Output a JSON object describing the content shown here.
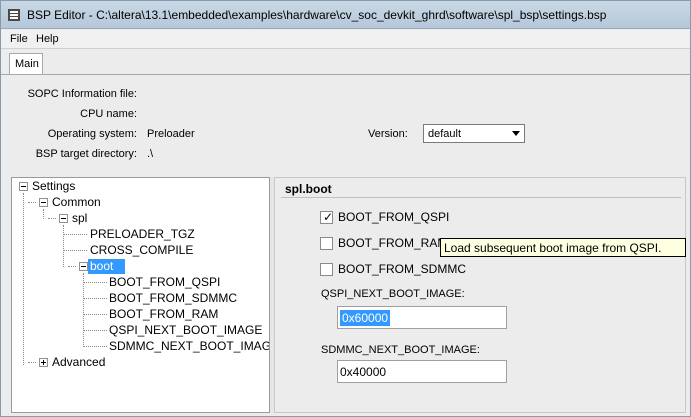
{
  "window": {
    "title": "BSP Editor - C:\\altera\\13.1\\embedded\\examples\\hardware\\cv_soc_devkit_ghrd\\software\\spl_bsp\\settings.bsp"
  },
  "menu": {
    "file": "File",
    "help": "Help"
  },
  "tabs": {
    "main": "Main"
  },
  "info": {
    "sopc_label": "SOPC Information file:",
    "cpu_label": "CPU name:",
    "os_label": "Operating system:",
    "os_value": "Preloader",
    "bsp_dir_label": "BSP target directory:",
    "bsp_dir_value": ".\\",
    "version_label": "Version:",
    "version_value": "default"
  },
  "tree": {
    "settings": "Settings",
    "common": "Common",
    "spl": "spl",
    "preloader_tgz": "PRELOADER_TGZ",
    "cross_compile": "CROSS_COMPILE",
    "boot": "boot",
    "boot_from_qspi": "BOOT_FROM_QSPI",
    "boot_from_sdmmc": "BOOT_FROM_SDMMC",
    "boot_from_ram": "BOOT_FROM_RAM",
    "qspi_next": "QSPI_NEXT_BOOT_IMAGE",
    "sdmmc_next": "SDMMC_NEXT_BOOT_IMAGE",
    "advanced": "Advanced"
  },
  "detail": {
    "section_title": "spl.boot",
    "boot_from_qspi_label": "BOOT_FROM_QSPI",
    "boot_from_qspi_checked": true,
    "boot_from_ram_label": "BOOT_FROM_RAM",
    "boot_from_ram_checked": false,
    "boot_from_sdmmc_label": "BOOT_FROM_SDMMC",
    "boot_from_sdmmc_checked": false,
    "qspi_next_label": "QSPI_NEXT_BOOT_IMAGE:",
    "qspi_next_value": "0x60000",
    "sdmmc_next_label": "SDMMC_NEXT_BOOT_IMAGE:",
    "sdmmc_next_value": "0x40000"
  },
  "tooltip": {
    "text": "Load subsequent boot image from QSPI."
  },
  "colors": {
    "selection": "#3399ff",
    "tooltip_bg": "#ffffe1"
  }
}
